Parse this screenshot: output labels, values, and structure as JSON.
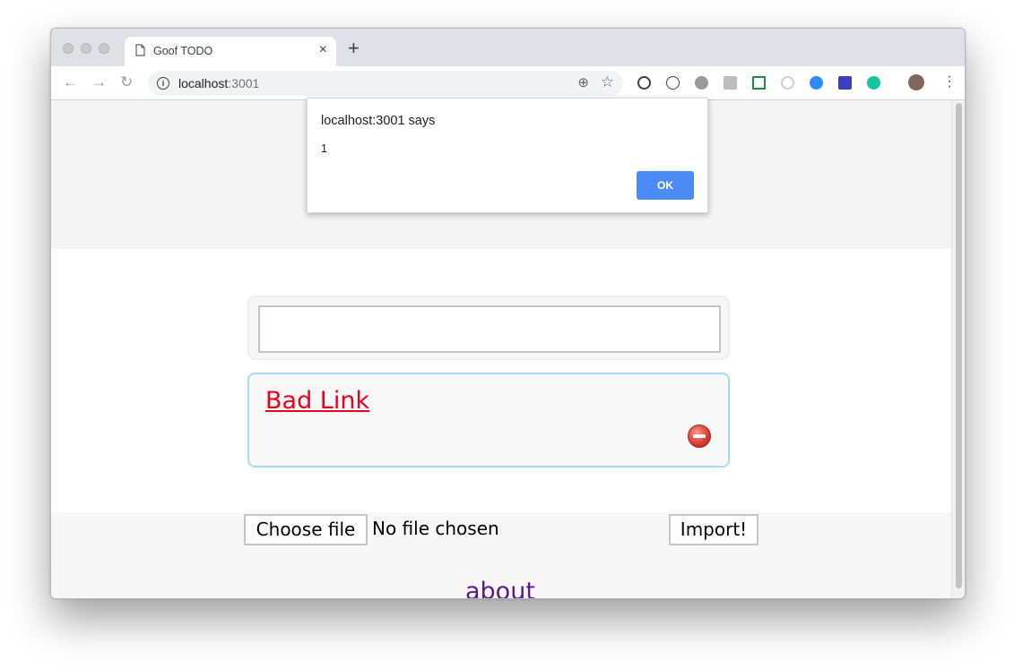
{
  "browser": {
    "tab_title": "Goof TODO",
    "url_host": "localhost",
    "url_port": ":3001",
    "accent_color": "#4a8bf5"
  },
  "alert": {
    "title": "localhost:3001 says",
    "message": "1",
    "ok_label": "OK"
  },
  "todo": {
    "input_value": "",
    "items": [
      {
        "text": "Bad Link",
        "link_color": "#e8001c"
      }
    ]
  },
  "import": {
    "choose_file_label": "Choose file",
    "file_status": "No file chosen",
    "import_label": "Import!"
  },
  "footer": {
    "about_label": "about"
  },
  "icons": {
    "delete": "minus-circle-icon",
    "info": "info-icon"
  }
}
